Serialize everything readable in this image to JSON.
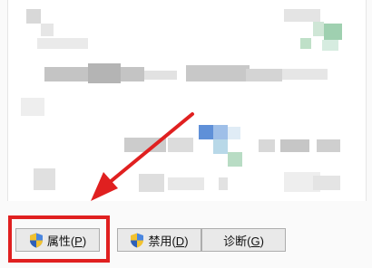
{
  "buttons": {
    "properties": {
      "text": "属性(",
      "key": "P",
      "close": ")"
    },
    "disable": {
      "text": "禁用(",
      "key": "D",
      "close": ")"
    },
    "diagnose": {
      "text": "诊断(",
      "key": "G",
      "close": ")"
    }
  },
  "annotation_color": "#e02020",
  "icons": {
    "button_icon": "uac-shield-icon"
  }
}
